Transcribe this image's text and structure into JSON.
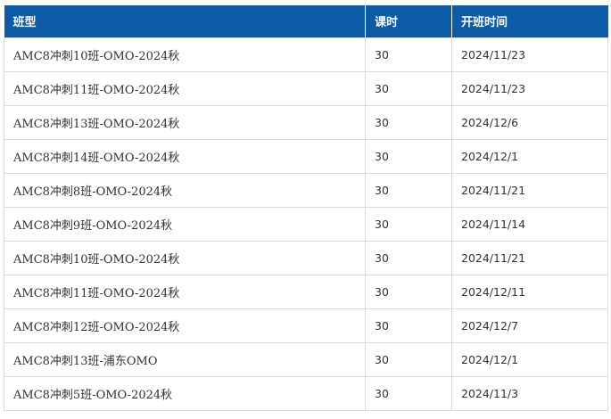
{
  "table": {
    "headers": [
      "班型",
      "课时",
      "开班时间"
    ],
    "rows": [
      [
        "AMC8冲刺10班-OMO-2024秋",
        "30",
        "2024/11/23"
      ],
      [
        "AMC8冲刺11班-OMO-2024秋",
        "30",
        "2024/11/23"
      ],
      [
        "AMC8冲刺13班-OMO-2024秋",
        "30",
        "2024/12/6"
      ],
      [
        "AMC8冲刺14班-OMO-2024秋",
        "30",
        "2024/12/1"
      ],
      [
        "AMC8冲刺8班-OMO-2024秋",
        "30",
        "2024/11/21"
      ],
      [
        "AMC8冲刺9班-OMO-2024秋",
        "30",
        "2024/11/14"
      ],
      [
        "AMC8冲刺10班-OMO-2024秋",
        "30",
        "2024/11/21"
      ],
      [
        "AMC8冲刺11班-OMO-2024秋",
        "30",
        "2024/12/11"
      ],
      [
        "AMC8冲刺12班-OMO-2024秋",
        "30",
        "2024/12/7"
      ],
      [
        "AMC8冲刺13班-浦东OMO",
        "30",
        "2024/12/1"
      ],
      [
        "AMC8冲刺5班-OMO-2024秋",
        "30",
        "2024/11/3"
      ]
    ]
  },
  "colors": {
    "header_bg": "#0c5aa8",
    "header_text": "#ffffff",
    "border": "#dcdcdc",
    "cell_text": "#333333"
  }
}
